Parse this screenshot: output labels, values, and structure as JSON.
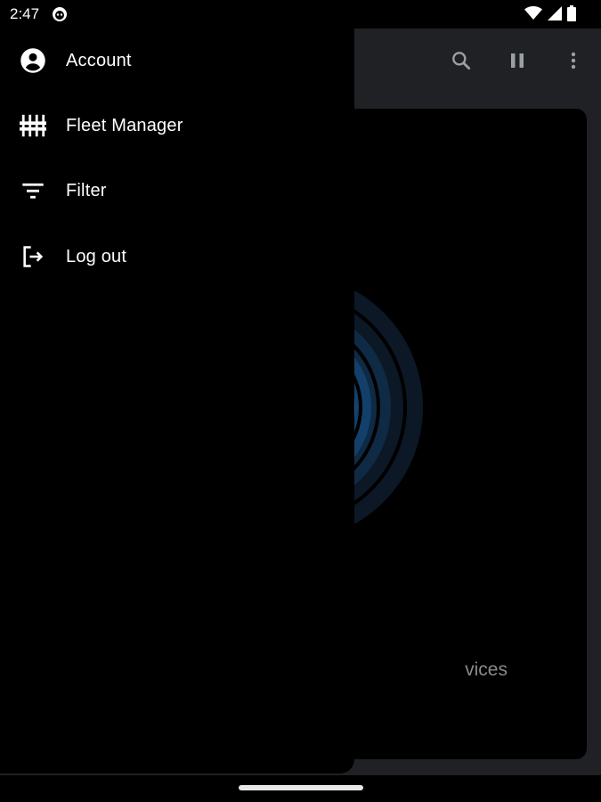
{
  "status_bar": {
    "time": "2:47"
  },
  "drawer": {
    "items": [
      {
        "label": "Account",
        "icon": "account-circle-icon"
      },
      {
        "label": "Fleet Manager",
        "icon": "fleet-manager-icon"
      },
      {
        "label": "Filter",
        "icon": "filter-icon"
      },
      {
        "label": "Log out",
        "icon": "logout-icon"
      }
    ]
  },
  "app_bar": {
    "icons": [
      "search-icon",
      "pause-icon",
      "more-vert-icon"
    ]
  },
  "content": {
    "empty_text_partial": "vices"
  },
  "colors": {
    "drawer_bg": "#000000",
    "app_bg": "#202124",
    "accent_blue": "#1a5a90"
  }
}
